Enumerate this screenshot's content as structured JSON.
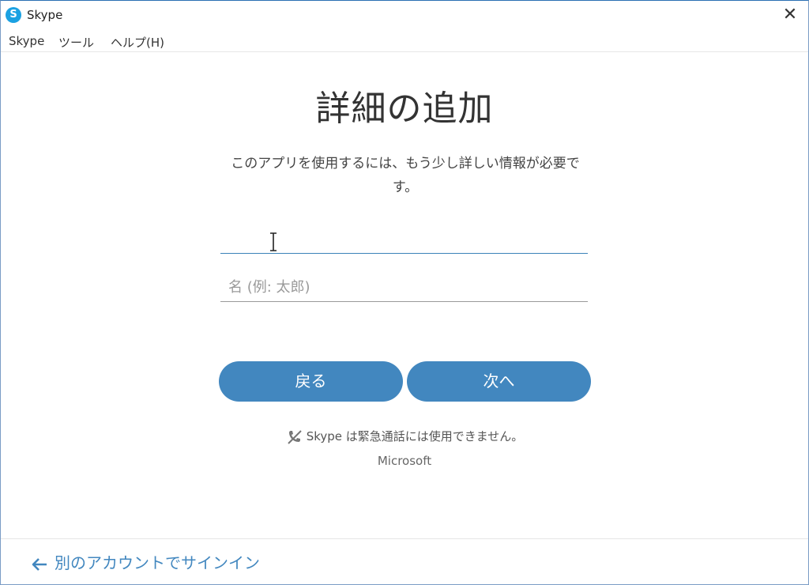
{
  "window": {
    "title": "Skype",
    "close_glyph": "✕",
    "logo_letter": "S"
  },
  "menu": {
    "items": [
      "Skype",
      "ツール",
      "ヘルプ(H)"
    ]
  },
  "main": {
    "heading": "詳細の追加",
    "description": "このアプリを使用するには、もう少し詳しい情報が必要です。",
    "last_name": {
      "value": "",
      "placeholder": ""
    },
    "first_name": {
      "value": "",
      "placeholder": "名 (例: 太郎)"
    },
    "back_label": "戻る",
    "next_label": "次へ",
    "emergency_notice": "Skype は緊急通話には使用できません。",
    "company": "Microsoft"
  },
  "footer": {
    "alt_signin_label": "別のアカウントでサインイン"
  },
  "colors": {
    "accent": "#4287bf",
    "skype_blue": "#1ba1e2",
    "text": "#333333"
  },
  "icons": {
    "logo": "skype-logo-icon",
    "close": "close-icon",
    "text_cursor": "text-cursor-icon",
    "no_emergency_call": "no-emergency-call-icon",
    "back_arrow": "arrow-left-icon"
  }
}
